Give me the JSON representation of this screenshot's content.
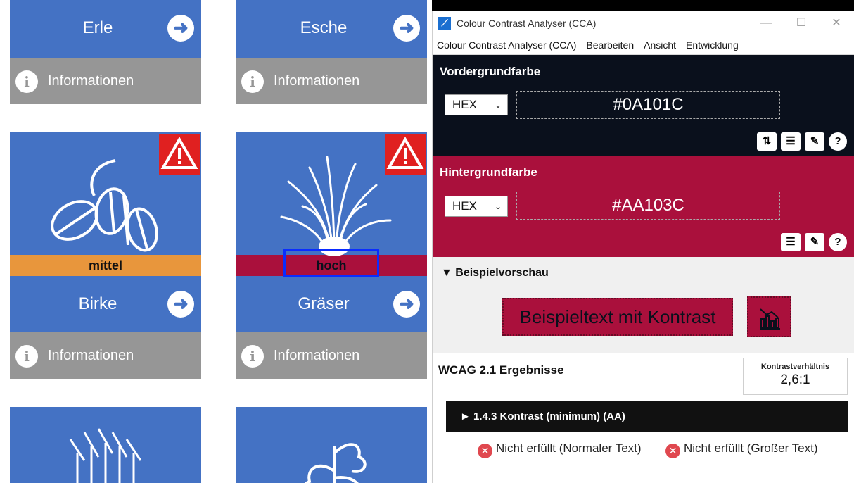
{
  "pollen_app": {
    "info_label": "Informationen",
    "cards": [
      {
        "name": "Erle"
      },
      {
        "name": "Esche"
      },
      {
        "name": "Birke",
        "level": "mittel",
        "level_color": "#e8963c"
      },
      {
        "name": "Gräser",
        "level": "hoch",
        "level_color": "#aa103c"
      }
    ],
    "colors": {
      "card_blue": "#4472c4",
      "info_gray": "#969696",
      "warning_red": "#e02020"
    }
  },
  "cca": {
    "window_title": "Colour Contrast Analyser (CCA)",
    "menu": [
      "Colour Contrast Analyser (CCA)",
      "Bearbeiten",
      "Ansicht",
      "Entwicklung"
    ],
    "foreground": {
      "heading": "Vordergrundfarbe",
      "format": "HEX",
      "value": "#0A101C"
    },
    "background": {
      "heading": "Hintergrundfarbe",
      "format": "HEX",
      "value": "#AA103C"
    },
    "preview": {
      "heading": "▼ Beispielvorschau",
      "sample_text": "Beispieltext mit Kontrast"
    },
    "results": {
      "heading": "WCAG 2.1 Ergebnisse",
      "ratio_label": "Kontrastverhältnis",
      "ratio_value": "2,6:1",
      "criterion": "► 1.4.3 Kontrast (minimum) (AA)",
      "normal_text": "Nicht erfüllt (Normaler Text)",
      "large_text": "Nicht erfüllt (Großer Text)"
    }
  }
}
